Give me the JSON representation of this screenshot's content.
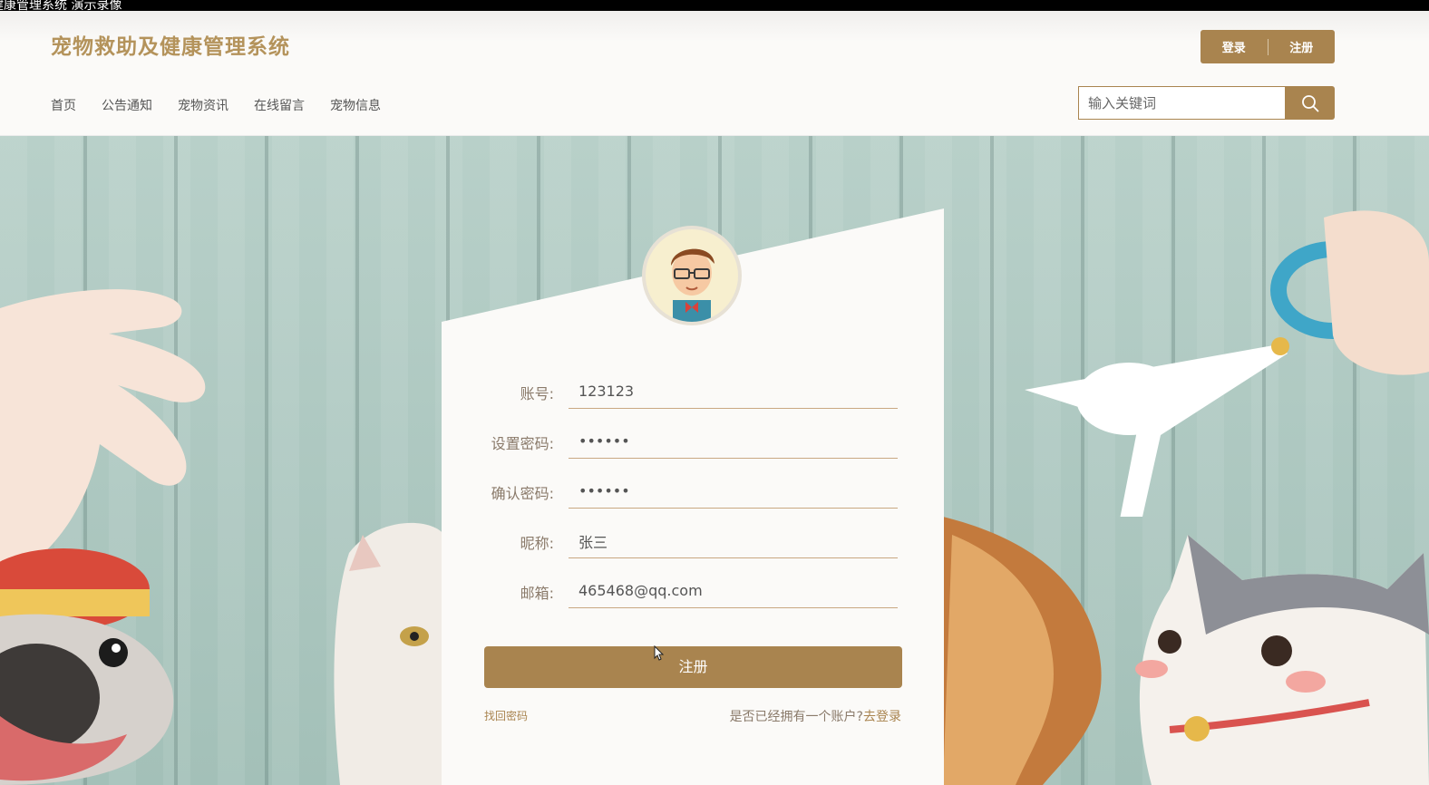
{
  "window": {
    "title": "健康管理系统 演示录像"
  },
  "header": {
    "site_title": "宠物救助及健康管理系统",
    "login_label": "登录",
    "register_label": "注册",
    "nav": [
      "首页",
      "公告通知",
      "宠物资讯",
      "在线留言",
      "宠物信息"
    ],
    "search_placeholder": "输入关键词"
  },
  "form": {
    "fields": [
      {
        "label": "账号:",
        "value": "123123",
        "type": "text"
      },
      {
        "label": "设置密码:",
        "value": "••••••",
        "type": "password"
      },
      {
        "label": "确认密码:",
        "value": "••••••",
        "type": "password"
      },
      {
        "label": "昵称:",
        "value": "张三",
        "type": "text"
      },
      {
        "label": "邮箱:",
        "value": "465468@qq.com",
        "type": "text"
      }
    ],
    "submit_label": "注册",
    "forgot_label": "找回密码",
    "has_account_text": "是否已经拥有一个账户?",
    "go_login_label": "去登录"
  },
  "colors": {
    "accent": "#a9844f",
    "title": "#b4935b"
  },
  "icons": {
    "search": "search-icon",
    "avatar": "avatar-icon"
  }
}
